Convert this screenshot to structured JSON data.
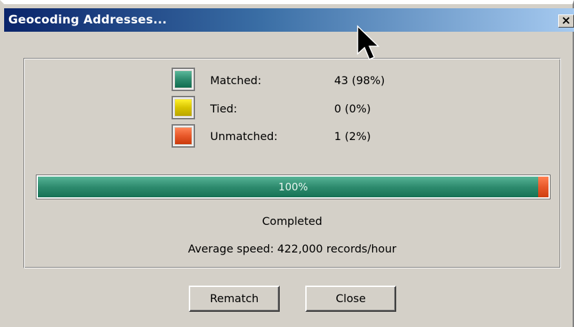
{
  "window": {
    "title": "Geocoding Addresses...",
    "close_label": "×"
  },
  "legend": [
    {
      "label": "Matched:",
      "value": "43 (98%)",
      "color": "#2e8b6e"
    },
    {
      "label": "Tied:",
      "value": "0 (0%)",
      "color": "#d8c400"
    },
    {
      "label": "Unmatched:",
      "value": "1 (2%)",
      "color": "#e8582a"
    }
  ],
  "progress": {
    "label": "100%",
    "matched_fraction": 0.98,
    "unmatched_fraction": 0.02,
    "matched_color": "#2e8b6e",
    "unmatched_color": "#e8582a"
  },
  "status": {
    "state": "Completed",
    "speed": "Average speed: 422,000 records/hour"
  },
  "buttons": {
    "rematch": "Rematch",
    "close": "Close"
  },
  "icons": {
    "cursor": "arrow-cursor-icon",
    "close": "close-icon"
  }
}
